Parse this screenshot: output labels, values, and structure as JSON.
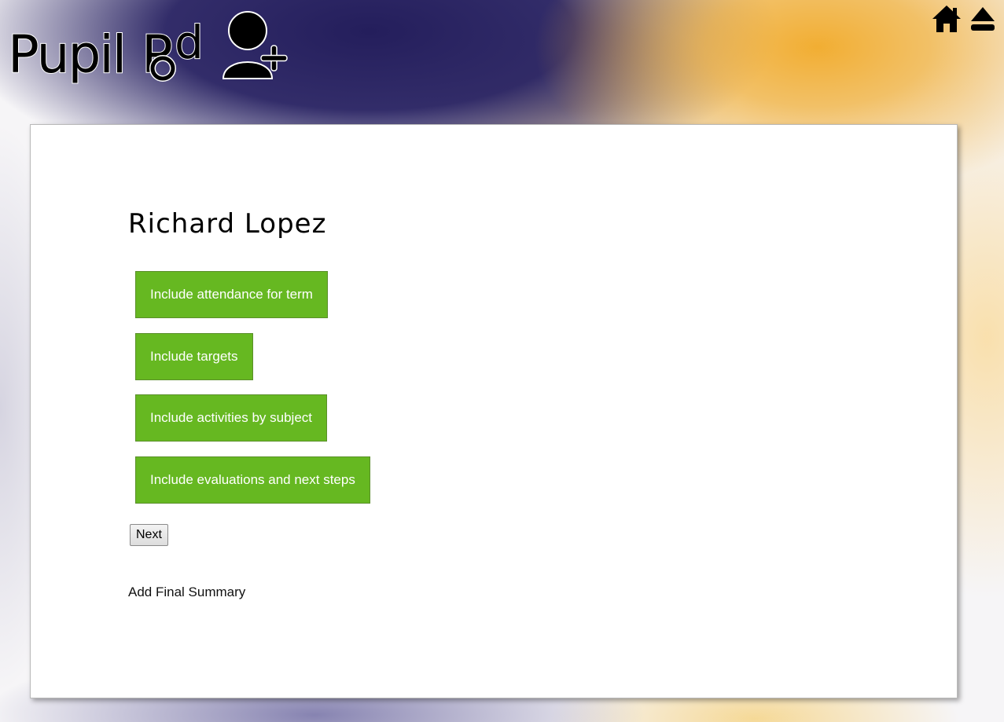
{
  "app": {
    "logo_text": "PupilPod",
    "logo_icon": "add-user-icon"
  },
  "header": {
    "icons": [
      {
        "name": "home-icon"
      },
      {
        "name": "eject-icon"
      }
    ]
  },
  "main": {
    "student_name": "Richard Lopez",
    "options": [
      {
        "label": "Include attendance for term"
      },
      {
        "label": "Include targets"
      },
      {
        "label": "Include activities by subject"
      },
      {
        "label": "Include evaluations and next steps"
      }
    ],
    "next_label": "Next",
    "final_summary_label": "Add Final Summary"
  },
  "colors": {
    "option_button_bg": "#66b821",
    "option_button_text": "#ffffff",
    "header_navy": "#241e5c",
    "header_amber": "#f1aa28"
  }
}
